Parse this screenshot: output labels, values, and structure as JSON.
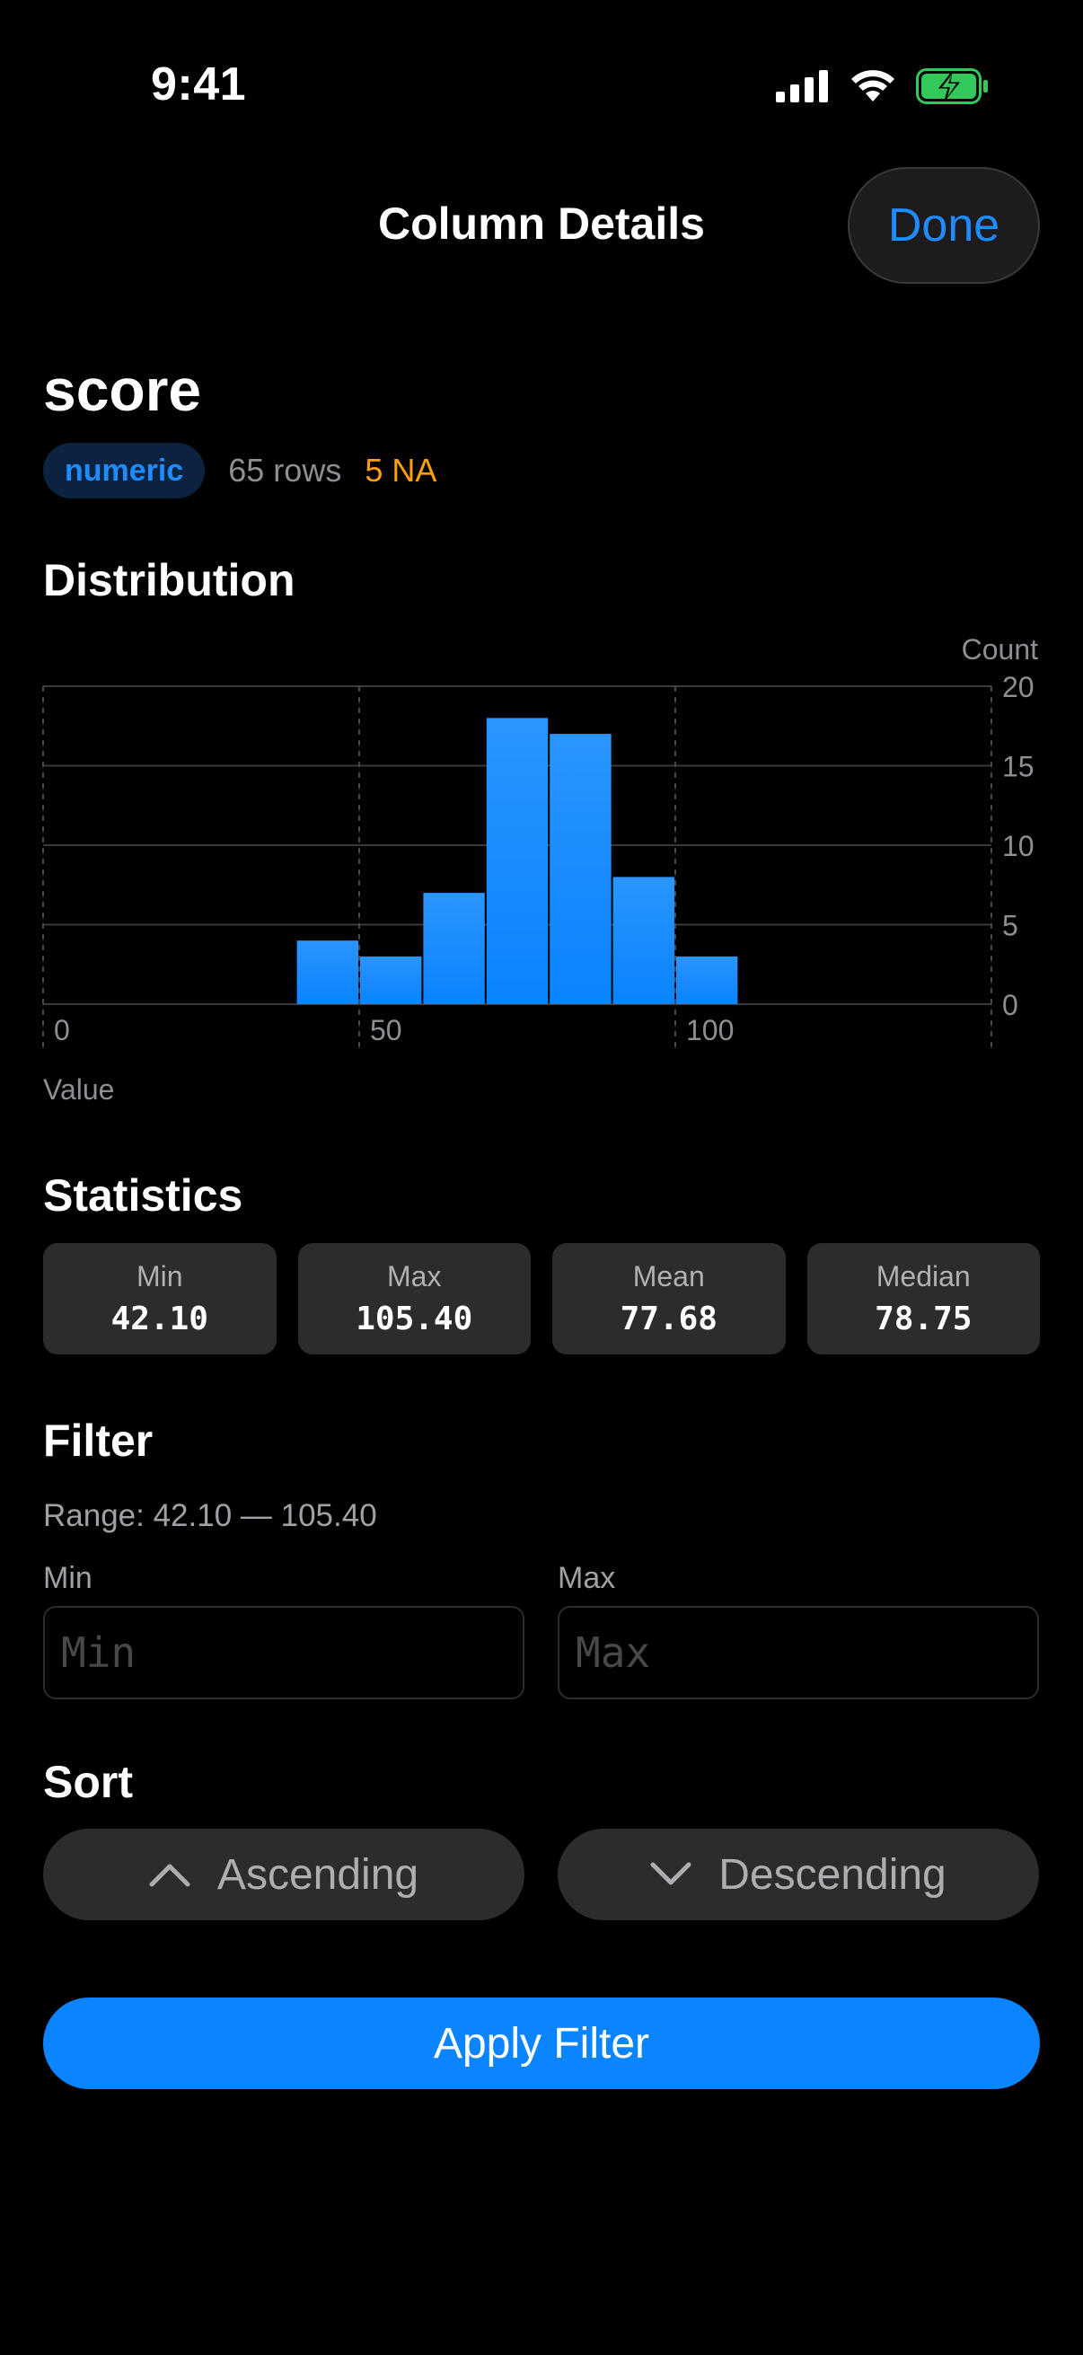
{
  "status_bar": {
    "time": "9:41"
  },
  "nav": {
    "title": "Column Details",
    "done_label": "Done"
  },
  "column": {
    "name": "score",
    "type": "numeric",
    "rows": "65 rows",
    "na": "5 NA"
  },
  "sections": {
    "distribution": "Distribution",
    "statistics": "Statistics",
    "filter": "Filter",
    "sort": "Sort"
  },
  "chart_data": {
    "type": "bar",
    "xlabel": "Value",
    "ylabel": "Count",
    "bin_width": 10,
    "bins": [
      {
        "start": 40,
        "end": 50,
        "count": 4
      },
      {
        "start": 50,
        "end": 60,
        "count": 3
      },
      {
        "start": 60,
        "end": 70,
        "count": 7
      },
      {
        "start": 70,
        "end": 80,
        "count": 18
      },
      {
        "start": 80,
        "end": 90,
        "count": 17
      },
      {
        "start": 90,
        "end": 100,
        "count": 8
      },
      {
        "start": 100,
        "end": 110,
        "count": 3
      }
    ],
    "x_ticks": [
      "0",
      "50",
      "100"
    ],
    "y_ticks": [
      "0",
      "5",
      "10",
      "15",
      "20"
    ],
    "xlim": [
      0,
      150
    ],
    "ylim": [
      0,
      20
    ],
    "bar_color": "#0a84ff"
  },
  "statistics": [
    {
      "label": "Min",
      "value": "42.10"
    },
    {
      "label": "Max",
      "value": "105.40"
    },
    {
      "label": "Mean",
      "value": "77.68"
    },
    {
      "label": "Median",
      "value": "78.75"
    }
  ],
  "filter": {
    "range_text": "Range: 42.10 — 105.40",
    "min_label": "Min",
    "max_label": "Max",
    "min_placeholder": "Min",
    "max_placeholder": "Max",
    "min_value": "",
    "max_value": ""
  },
  "sort": {
    "ascending": "Ascending",
    "descending": "Descending"
  },
  "apply_label": "Apply Filter",
  "colors": {
    "accent": "#0a84ff",
    "warning": "#ff9f0a",
    "background": "#000000"
  }
}
